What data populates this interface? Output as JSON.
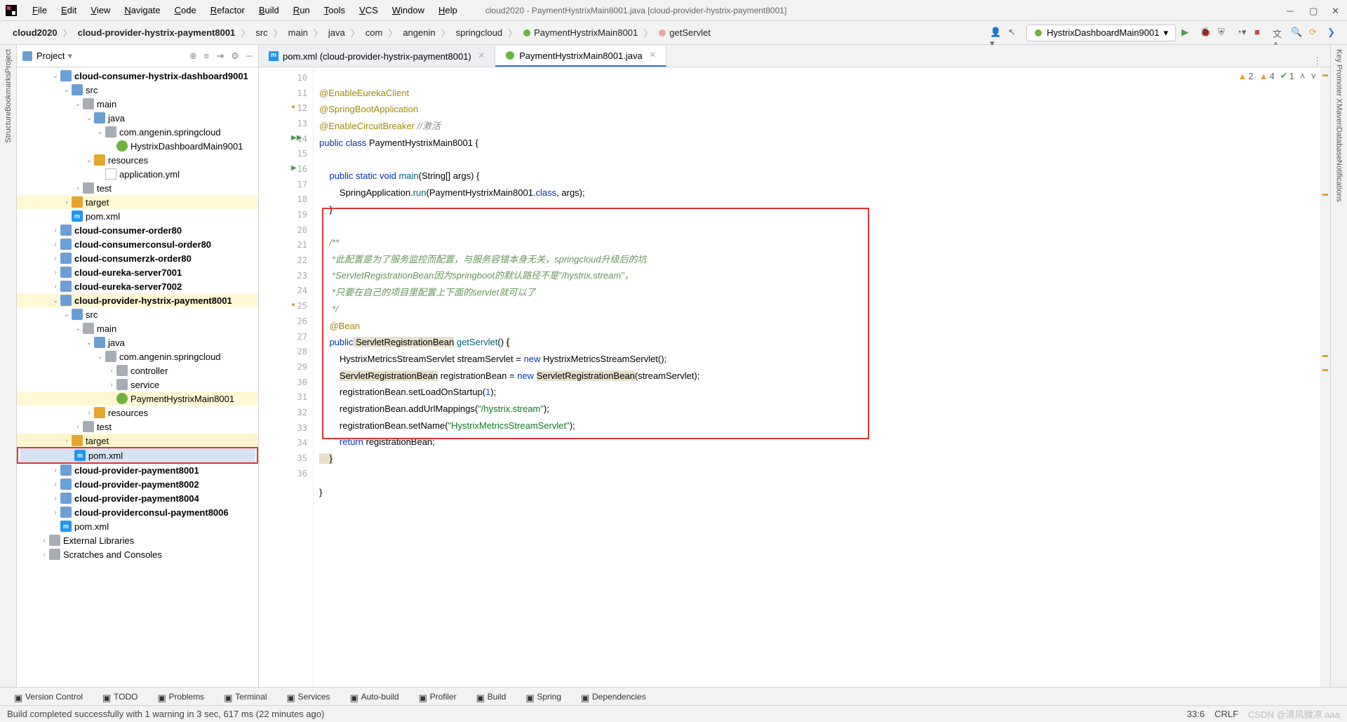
{
  "window": {
    "title": "cloud2020 - PaymentHystrixMain8001.java [cloud-provider-hystrix-payment8001]"
  },
  "menu": [
    "File",
    "Edit",
    "View",
    "Navigate",
    "Code",
    "Refactor",
    "Build",
    "Run",
    "Tools",
    "VCS",
    "Window",
    "Help"
  ],
  "breadcrumbs": [
    "cloud2020",
    "cloud-provider-hystrix-payment8001",
    "src",
    "main",
    "java",
    "com",
    "angenin",
    "springcloud",
    "PaymentHystrixMain8001",
    "getServlet"
  ],
  "runConfig": "HystrixDashboardMain9001",
  "projectPanel": {
    "label": "Project"
  },
  "tree": [
    {
      "d": 3,
      "t": "cloud-consumer-hystrix-dashboard9001",
      "exp": "v",
      "cls": "bold",
      "icon": "folder blue",
      "trunc": true
    },
    {
      "d": 4,
      "t": "src",
      "exp": "v",
      "icon": "folder blue"
    },
    {
      "d": 5,
      "t": "main",
      "exp": "v",
      "icon": "folder"
    },
    {
      "d": 6,
      "t": "java",
      "exp": "v",
      "icon": "folder blue"
    },
    {
      "d": 7,
      "t": "com.angenin.springcloud",
      "exp": "v",
      "icon": "folder"
    },
    {
      "d": 8,
      "t": "HystrixDashboardMain9001",
      "icon": "java"
    },
    {
      "d": 6,
      "t": "resources",
      "exp": "v",
      "icon": "folder o"
    },
    {
      "d": 7,
      "t": "application.yml",
      "icon": "file"
    },
    {
      "d": 5,
      "t": "test",
      "exp": ">",
      "icon": "folder"
    },
    {
      "d": 4,
      "t": "target",
      "exp": ">",
      "icon": "folder o",
      "hl": "hl"
    },
    {
      "d": 4,
      "t": "pom.xml",
      "icon": "m"
    },
    {
      "d": 3,
      "t": "cloud-consumer-order80",
      "exp": ">",
      "cls": "bold",
      "icon": "folder blue"
    },
    {
      "d": 3,
      "t": "cloud-consumerconsul-order80",
      "exp": ">",
      "cls": "bold",
      "icon": "folder blue"
    },
    {
      "d": 3,
      "t": "cloud-consumerzk-order80",
      "exp": ">",
      "cls": "bold",
      "icon": "folder blue"
    },
    {
      "d": 3,
      "t": "cloud-eureka-server7001",
      "exp": ">",
      "cls": "bold",
      "icon": "folder blue"
    },
    {
      "d": 3,
      "t": "cloud-eureka-server7002",
      "exp": ">",
      "cls": "bold",
      "icon": "folder blue"
    },
    {
      "d": 3,
      "t": "cloud-provider-hystrix-payment8001",
      "exp": "v",
      "cls": "bold",
      "icon": "folder blue",
      "hl": "hl"
    },
    {
      "d": 4,
      "t": "src",
      "exp": "v",
      "icon": "folder blue"
    },
    {
      "d": 5,
      "t": "main",
      "exp": "v",
      "icon": "folder"
    },
    {
      "d": 6,
      "t": "java",
      "exp": "v",
      "icon": "folder blue"
    },
    {
      "d": 7,
      "t": "com.angenin.springcloud",
      "exp": "v",
      "icon": "folder"
    },
    {
      "d": 8,
      "t": "controller",
      "exp": ">",
      "icon": "folder"
    },
    {
      "d": 8,
      "t": "service",
      "exp": ">",
      "icon": "folder"
    },
    {
      "d": 8,
      "t": "PaymentHystrixMain8001",
      "icon": "java",
      "hl": "hl"
    },
    {
      "d": 6,
      "t": "resources",
      "exp": ">",
      "icon": "folder o"
    },
    {
      "d": 5,
      "t": "test",
      "exp": ">",
      "icon": "folder"
    },
    {
      "d": 4,
      "t": "target",
      "exp": ">",
      "icon": "folder o",
      "hl": "hl2"
    },
    {
      "d": 4,
      "t": "pom.xml",
      "icon": "m",
      "sel": true,
      "redbox": true
    },
    {
      "d": 3,
      "t": "cloud-provider-payment8001",
      "exp": ">",
      "cls": "bold",
      "icon": "folder blue"
    },
    {
      "d": 3,
      "t": "cloud-provider-payment8002",
      "exp": ">",
      "cls": "bold",
      "icon": "folder blue"
    },
    {
      "d": 3,
      "t": "cloud-provider-payment8004",
      "exp": ">",
      "cls": "bold",
      "icon": "folder blue"
    },
    {
      "d": 3,
      "t": "cloud-providerconsul-payment8006",
      "exp": ">",
      "cls": "bold",
      "icon": "folder blue"
    },
    {
      "d": 3,
      "t": "pom.xml",
      "icon": "m"
    },
    {
      "d": 2,
      "t": "External Libraries",
      "exp": ">",
      "icon": "folder"
    },
    {
      "d": 2,
      "t": "Scratches and Consoles",
      "exp": ">",
      "icon": "folder"
    }
  ],
  "tabs": [
    {
      "label": "pom.xml (cloud-provider-hystrix-payment8001)",
      "icon": "m",
      "active": false
    },
    {
      "label": "PaymentHystrixMain8001.java",
      "icon": "java",
      "active": true
    }
  ],
  "inspections": {
    "warn1": "2",
    "warn2": "4",
    "ok": "1"
  },
  "gutterLines": [
    "10",
    "11",
    "12",
    "13",
    "14",
    "15",
    "16",
    "17",
    "18",
    "19",
    "20",
    "21",
    "22",
    "23",
    "24",
    "25",
    "26",
    "27",
    "28",
    "29",
    "30",
    "31",
    "32",
    "33",
    "34",
    "35",
    "36"
  ],
  "code": {
    "l10": "",
    "l11": "@EnableEurekaClient",
    "l12": "@SpringBootApplication",
    "l13a": "@EnableCircuitBreaker",
    "l13b": " //激活",
    "l14a": "public",
    "l14b": " class",
    "l14c": " PaymentHystrixMain8001 {",
    "l15": "",
    "l16a": "    public",
    "l16b": " static",
    "l16c": " void",
    "l16d": " main",
    "l16e": "(String[] args) {",
    "l17a": "        SpringApplication.",
    "l17b": "run",
    "l17c": "(PaymentHystrixMain8001.",
    "l17d": "class",
    "l17e": ", args);",
    "l18": "    }",
    "l19": "",
    "l20": "    /**",
    "l21": "     *此配置是为了服务监控而配置，与服务容错本身无关，springcloud升级后的坑",
    "l22a": "     *ServletRegistrationBean因为springboot的默认路径不是",
    "l22b": "\"/hystrix.stream\"",
    "l22c": "，",
    "l23": "     *只要在自己的项目里配置上下面的servlet就可以了",
    "l24": "     */",
    "l25": "    @Bean",
    "l26a": "    public",
    "l26b": " ServletRegistrationBean",
    "l26c": " getServlet",
    "l26d": "() ",
    "l26e": "{",
    "l27a": "        HystrixMetricsStreamServlet streamServlet = ",
    "l27b": "new",
    "l27c": " HystrixMetricsStreamServlet();",
    "l28a": "        ",
    "l28b": "ServletRegistrationBean",
    "l28c": " registrationBean = ",
    "l28d": "new",
    "l28e": " ",
    "l28f": "ServletRegistrationBean",
    "l28g": "(streamServlet);",
    "l29a": "        registrationBean.setLoadOnStartup(",
    "l29b": "1",
    "l29c": ");",
    "l30a": "        registrationBean.addUrlMappings(",
    "l30b": "\"/hystrix.stream\"",
    "l30c": ");",
    "l31a": "        registrationBean.setName(",
    "l31b": "\"HystrixMetricsStreamServlet\"",
    "l31c": ");",
    "l32a": "        ",
    "l32b": "return",
    "l32c": " registrationBean;",
    "l33": "    }",
    "l34": "",
    "l35": "}",
    "l36": ""
  },
  "bottomTools": [
    "Version Control",
    "TODO",
    "Problems",
    "Terminal",
    "Services",
    "Auto-build",
    "Profiler",
    "Build",
    "Spring",
    "Dependencies"
  ],
  "status": {
    "msg": "Build completed successfully with 1 warning in 3 sec, 617 ms (22 minutes ago)",
    "pos": "33:6",
    "enc": "CRLF"
  },
  "watermark": "CSDN @清风微凉 aaa",
  "rightRail": [
    "Key Promoter X",
    "Maven",
    "Database",
    "Notifications"
  ],
  "leftRail": [
    "Project",
    "Bookmarks",
    "Structure"
  ]
}
